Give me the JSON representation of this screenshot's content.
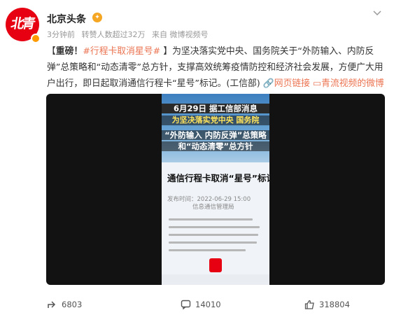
{
  "author": {
    "name": "北京头条",
    "avatar_text": "北青"
  },
  "meta": {
    "time": "3分钟前",
    "reposts": "转赞人数超过32万",
    "source": "来自 微博视频号"
  },
  "post": {
    "bracket_open": "【",
    "alert": "重磅！",
    "hashtag": "#行程卡取消星号#",
    "bracket_close": " 】",
    "body": "为坚决落实党中央、国务院关于“外防输入、内防反弹”总策略和“动态清零”总方针，支撑高效统筹疫情防控和经济社会发展，方便广大用户出行，即日起取消通信行程卡“星号”标记。(工信部) ",
    "link_web": "网页链接",
    "link_video": "青流视频的微博视频"
  },
  "video": {
    "line1": "6月29日 据工信部消息",
    "line2": "为坚决落实党中央 国务院",
    "line3": "“外防输入 内防反弹”总策略",
    "line4": "和“动态清零”总方针",
    "headline": "通信行程卡取消“星号”标记",
    "date": "发布时间：2022-06-29 15:00",
    "source": "信息通信管理局"
  },
  "actions": {
    "share_count": "6803",
    "comment_count": "14010",
    "like_count": "318804"
  },
  "colors": {
    "accent": "#eb7350",
    "brand_red": "#e60012"
  }
}
